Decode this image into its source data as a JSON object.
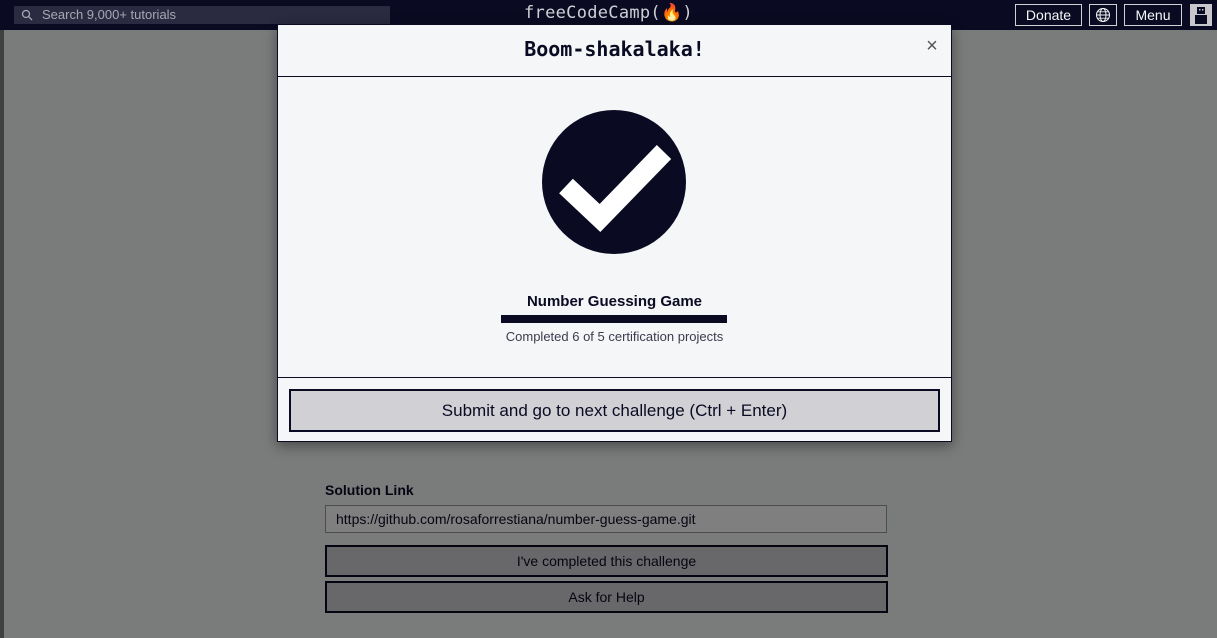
{
  "nav": {
    "search_placeholder": "Search 9,000+ tutorials",
    "logo": "freeCodeCamp(🔥)",
    "donate": "Donate",
    "menu": "Menu"
  },
  "page": {
    "solution_label": "Solution Link",
    "solution_value": "https://github.com/rosaforrestiana/number-guess-game.git",
    "completed_button": "I've completed this challenge",
    "help_button": "Ask for Help"
  },
  "modal": {
    "title": "Boom-shakalaka!",
    "close": "×",
    "project_title": "Number Guessing Game",
    "progress_fraction": 1.0,
    "progress_text": "Completed 6 of 5 certification projects",
    "submit_button": "Submit and go to next challenge (Ctrl + Enter)"
  },
  "colors": {
    "brand_dark": "#0a0a23",
    "surface": "#f5f6f7",
    "button_gray": "#d0d0d5"
  }
}
